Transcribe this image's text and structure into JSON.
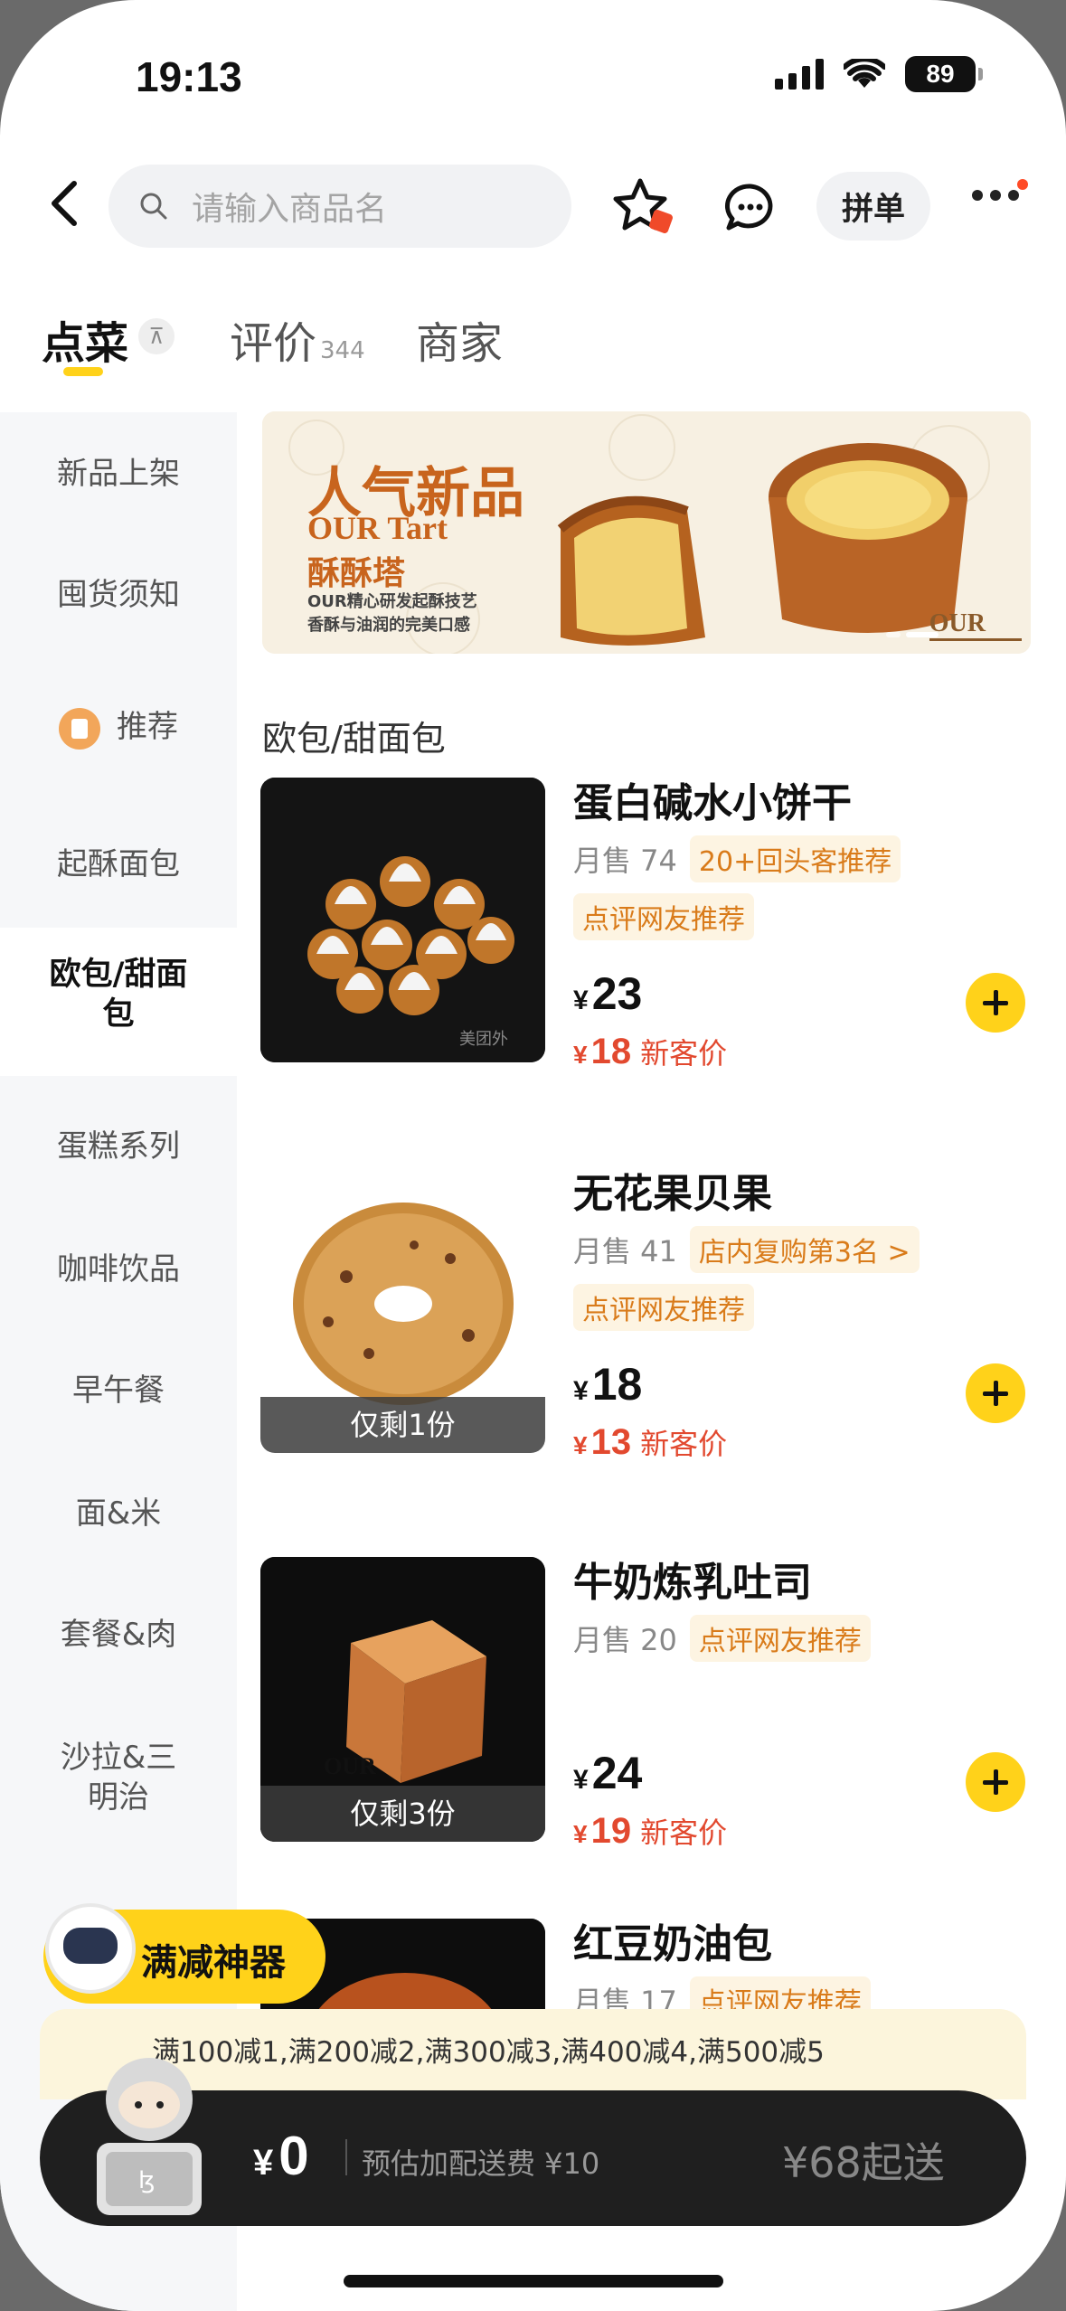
{
  "status_bar": {
    "time": "19:13",
    "battery": "89"
  },
  "search": {
    "placeholder": "请输入商品名"
  },
  "header": {
    "pindan_label": "拼单"
  },
  "tabs": [
    {
      "label": "点菜",
      "sub": ""
    },
    {
      "label": "评价",
      "sub": "344"
    },
    {
      "label": "商家",
      "sub": ""
    }
  ],
  "sidebar": {
    "items": [
      {
        "label": "新品上架"
      },
      {
        "label": "囤货须知"
      },
      {
        "label": "推荐"
      },
      {
        "label": "起酥面包"
      },
      {
        "label": "欧包/甜面包"
      },
      {
        "label": "蛋糕系列"
      },
      {
        "label": "咖啡饮品"
      },
      {
        "label": "早午餐"
      },
      {
        "label": "面&米"
      },
      {
        "label": "套餐&肉"
      },
      {
        "label": "沙拉&三明治"
      }
    ]
  },
  "banner": {
    "title": "人气新品",
    "subtitle_en": "OUR Tart",
    "subtitle_cn": "酥酥塔",
    "desc_line1": "OUR精心研发起酥技艺",
    "desc_line2": "香酥与油润的完美口感",
    "logo": "OUR"
  },
  "section": {
    "title": "欧包/甜面包"
  },
  "currency": "¥",
  "products": [
    {
      "name": "蛋白碱水小饼干",
      "sold": "月售 74",
      "tag1": "20+回头客推荐",
      "tag2": "点评网友推荐",
      "price": "23",
      "new_price": "18",
      "new_label": "新客价",
      "stock": ""
    },
    {
      "name": "无花果贝果",
      "sold": "月售 41",
      "tag1": "店内复购第3名 >",
      "tag2": "点评网友推荐",
      "price": "18",
      "new_price": "13",
      "new_label": "新客价",
      "stock": "仅剩1份"
    },
    {
      "name": "牛奶炼乳吐司",
      "sold": "月售 20",
      "tag1": "点评网友推荐",
      "tag2": "",
      "price": "24",
      "new_price": "19",
      "new_label": "新客价",
      "stock": "仅剩3份"
    },
    {
      "name": "红豆奶油包",
      "sold": "月售 17",
      "tag1": "点评网友推荐",
      "tag2": "",
      "price": "",
      "new_price": "",
      "new_label": "",
      "stock": ""
    }
  ],
  "promo": {
    "badge": "满减神器",
    "text": "满100减1,满200减2,满300减3,满400减4,满500减5"
  },
  "cart": {
    "total": "0",
    "delivery_fee": "预估加配送费 ¥10",
    "min_order": "¥68起送"
  },
  "colors": {
    "accent": "#ffd21a",
    "price_red": "#e2492f",
    "tag_orange": "#d97b1a"
  }
}
